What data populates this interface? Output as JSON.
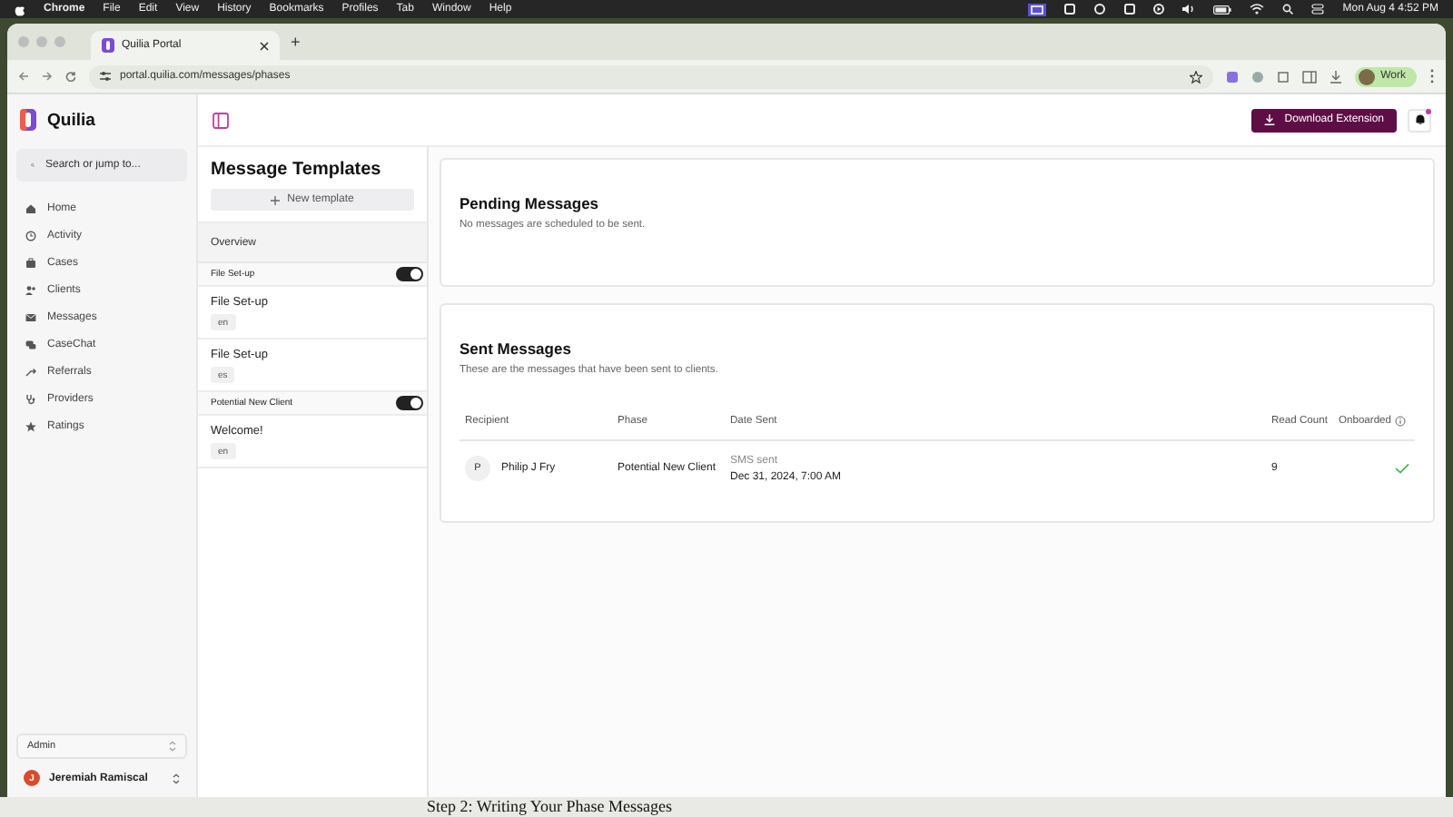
{
  "menu_bar": {
    "app": "Chrome",
    "items": [
      "File",
      "Edit",
      "View",
      "History",
      "Bookmarks",
      "Profiles",
      "Tab",
      "Window",
      "Help"
    ],
    "clock": "Mon Aug 4  4:52 PM"
  },
  "browser": {
    "tab_title": "Quilia Portal",
    "new_tab": "+",
    "url": "portal.quilia.com/messages/phases",
    "profile": "Work"
  },
  "sidebar": {
    "brand": "Quilia",
    "search": {
      "placeholder": "Search or jump to..."
    },
    "nav": [
      {
        "label": "Home",
        "selected": false
      },
      {
        "label": "Activity",
        "selected": false
      },
      {
        "label": "Cases",
        "selected": false
      },
      {
        "label": "Clients",
        "selected": false
      },
      {
        "label": "Messages",
        "selected": false
      },
      {
        "label": "CaseChat",
        "selected": false
      },
      {
        "label": "Referrals",
        "selected": false
      },
      {
        "label": "Providers",
        "selected": false
      },
      {
        "label": "Ratings",
        "selected": false
      }
    ],
    "role": "Admin",
    "user": {
      "initial": "J",
      "name": "Jeremiah Ramiscal"
    }
  },
  "topbar": {
    "download_button": "Download Extension",
    "has_notification": true
  },
  "templates": {
    "title": "Message Templates",
    "new_button": "New template",
    "overview": "Overview",
    "groups": [
      {
        "name": "File Set-up",
        "enabled": true,
        "items": [
          {
            "title": "File Set-up",
            "lang": "en"
          },
          {
            "title": "File Set-up",
            "lang": "es"
          }
        ]
      },
      {
        "name": "Potential New Client",
        "enabled": true,
        "items": [
          {
            "title": "Welcome!",
            "lang": "en"
          }
        ]
      }
    ]
  },
  "pending": {
    "title": "Pending Messages",
    "description": "No messages are scheduled to be sent."
  },
  "sent": {
    "title": "Sent Messages",
    "description": "These are the messages that have been sent to clients.",
    "columns": [
      "Recipient",
      "Phase",
      "Date Sent",
      "Read Count",
      "Onboarded"
    ],
    "rows": [
      {
        "initial": "P",
        "recipient": "Philip J Fry",
        "phase": "Potential New Client",
        "status": "SMS sent",
        "date": "Dec 31, 2024, 7:00 AM",
        "read_count": "9",
        "onboarded": true
      }
    ]
  },
  "backdrop_text": "Step 2: Writing Your Phase Messages"
}
